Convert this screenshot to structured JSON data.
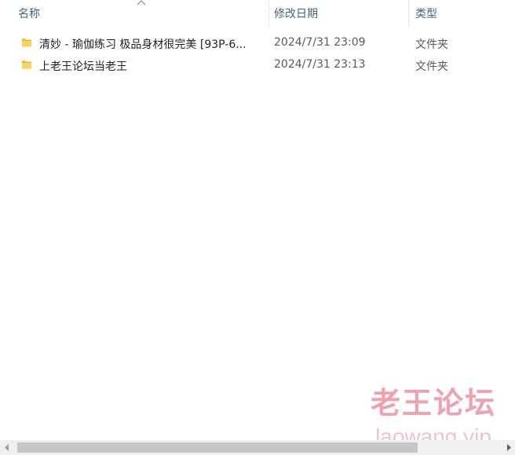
{
  "columns": {
    "name": "名称",
    "date_modified": "修改日期",
    "type": "类型"
  },
  "sort": {
    "column": "name",
    "direction": "ascending",
    "icon": "sort-up-icon"
  },
  "files": [
    {
      "icon": "folder-icon",
      "name": "清妙 -  瑜伽练习 极品身材很完美 [93P-6...",
      "date_modified": "2024/7/31 23:09",
      "type": "文件夹"
    },
    {
      "icon": "folder-icon",
      "name": "上老王论坛当老王",
      "date_modified": "2024/7/31 23:13",
      "type": "文件夹"
    }
  ],
  "watermark": {
    "title": "老王论坛",
    "site": "laowang.vip"
  },
  "colors": {
    "folder": "#f4c443",
    "header_text": "#4c607a",
    "scrollbar_thumb": "#c6c6c6",
    "watermark": "#e98296"
  },
  "scrollbar": {
    "horizontal_thumb_fraction": 0.82
  }
}
